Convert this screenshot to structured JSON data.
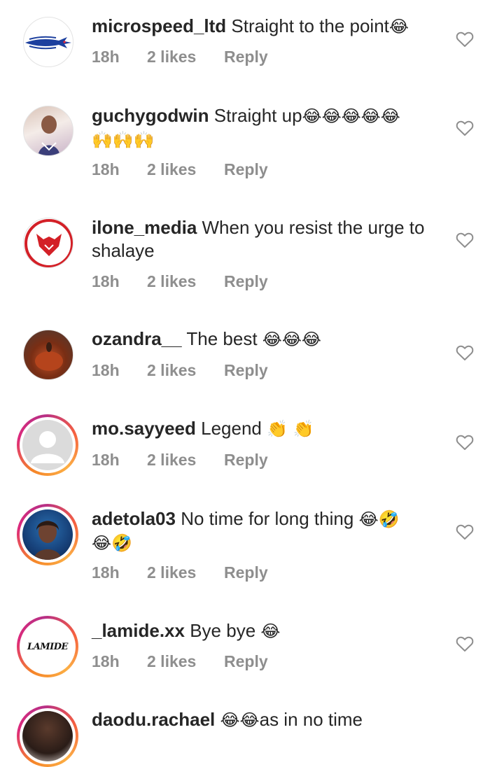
{
  "comments": [
    {
      "username": "microspeed_ltd",
      "text": "Straight to the point",
      "emoji": "😂",
      "time": "18h",
      "likes": "2 likes",
      "reply": "Reply"
    },
    {
      "username": "guchygodwin",
      "text": "Straight up",
      "emoji": "😂😂😂😂😂",
      "emoji2": "🙌🙌🙌",
      "time": "18h",
      "likes": "2 likes",
      "reply": "Reply"
    },
    {
      "username": "ilone_media",
      "text": "When you resist the urge to shalaye",
      "time": "18h",
      "likes": "2 likes",
      "reply": "Reply"
    },
    {
      "username": "ozandra__",
      "text": "The best",
      "emoji": "😂😂😂",
      "time": "18h",
      "likes": "2 likes",
      "reply": "Reply"
    },
    {
      "username": "mo.sayyeed",
      "text": "Legend",
      "emoji": "👏 👏",
      "time": "18h",
      "likes": "2 likes",
      "reply": "Reply"
    },
    {
      "username": "adetola03",
      "text": "No time for long thing",
      "emoji": "😂🤣",
      "emoji2": "😂🤣",
      "time": "18h",
      "likes": "2 likes",
      "reply": "Reply"
    },
    {
      "username": "_lamide.xx",
      "text": "Bye bye",
      "emoji": "😂",
      "time": "18h",
      "likes": "2 likes",
      "reply": "Reply",
      "avatar_text": "LAMIDE"
    },
    {
      "username": "daodu.rachael",
      "emoji": "😂😂",
      "text": "as in no time"
    }
  ],
  "colors": {
    "text": "#262626",
    "meta": "#8e8e8e",
    "story_ring": "#dd2a7b",
    "heart": "#8e8e8e"
  },
  "icons": {
    "like": "heart-outline-icon"
  }
}
